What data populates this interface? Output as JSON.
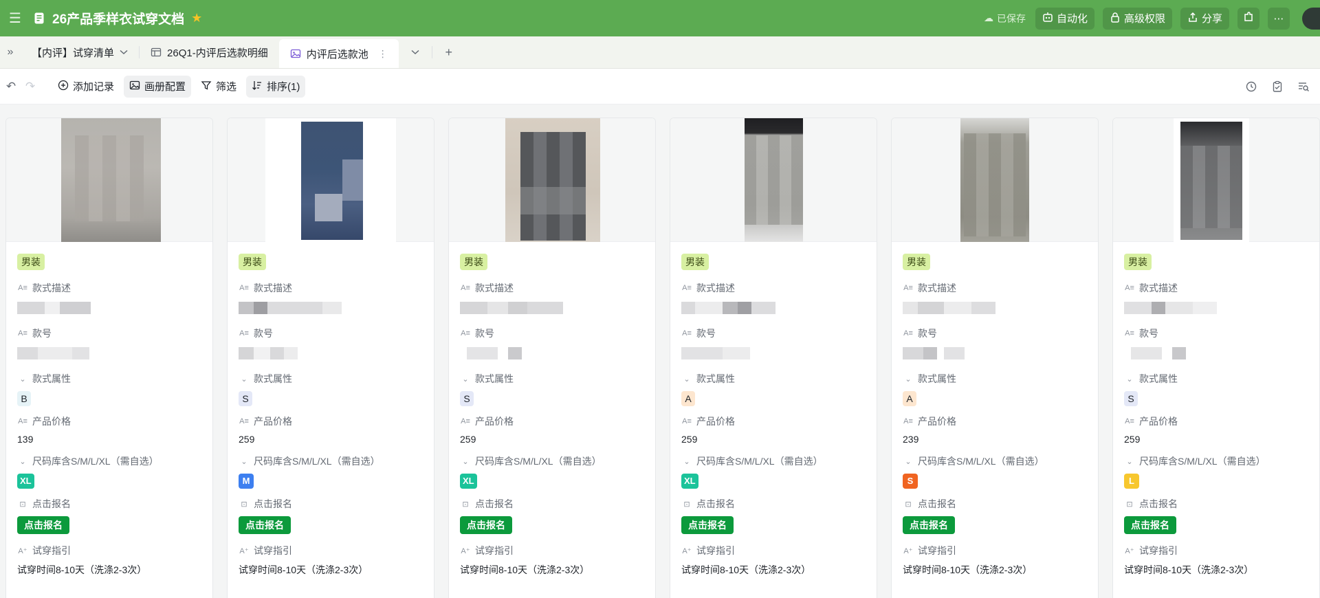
{
  "titlebar": {
    "doc_title": "26产品季样衣试穿文档",
    "saved_status": "已保存",
    "automation_label": "自动化",
    "permissions_label": "高级权限",
    "share_label": "分享",
    "more_glyph": "⋯",
    "color": "#5cab52"
  },
  "tabs": [
    {
      "label": "【内评】试穿清单"
    },
    {
      "label": "26Q1-内评后选款明细"
    },
    {
      "label": "内评后选款池"
    }
  ],
  "toolbar": {
    "add_record": "添加记录",
    "gallery_config": "画册配置",
    "filter": "筛选",
    "sort": "排序(1)"
  },
  "labels": {
    "style_desc": "款式描述",
    "style_no": "款号",
    "style_attr": "款式属性",
    "price": "产品价格",
    "size": "尺码库含S/M/L/XL（需自选）",
    "signup": "点击报名",
    "guide": "试穿指引"
  },
  "cards": [
    {
      "category": "男装",
      "attr": "B",
      "price": "139",
      "size": "XL",
      "signup_btn": "点击报名",
      "guide_text": "试穿时间8-10天（洗涤2-3次）"
    },
    {
      "category": "男装",
      "attr": "S",
      "price": "259",
      "size": "M",
      "signup_btn": "点击报名",
      "guide_text": "试穿时间8-10天（洗涤2-3次）"
    },
    {
      "category": "男装",
      "attr": "S",
      "price": "259",
      "size": "XL",
      "signup_btn": "点击报名",
      "guide_text": "试穿时间8-10天（洗涤2-3次）"
    },
    {
      "category": "男装",
      "attr": "A",
      "price": "259",
      "size": "XL",
      "signup_btn": "点击报名",
      "guide_text": "试穿时间8-10天（洗涤2-3次）"
    },
    {
      "category": "男装",
      "attr": "A",
      "price": "239",
      "size": "S",
      "signup_btn": "点击报名",
      "guide_text": "试穿时间8-10天（洗涤2-3次）"
    },
    {
      "category": "男装",
      "attr": "S",
      "price": "259",
      "size": "L",
      "signup_btn": "点击报名",
      "guide_text": "试穿时间8-10天（洗涤2-3次）"
    }
  ],
  "colors": {
    "attr_B": "#e6f3f7",
    "attr_S": "#e4e8f7",
    "attr_A": "#fde6cf",
    "size_XL": "#1bc39a",
    "size_M": "#3d7ff0",
    "size_S": "#f06421",
    "size_L": "#f7c72e",
    "signup": "#0c9a3c",
    "category_tag": "#d8f0a2"
  }
}
